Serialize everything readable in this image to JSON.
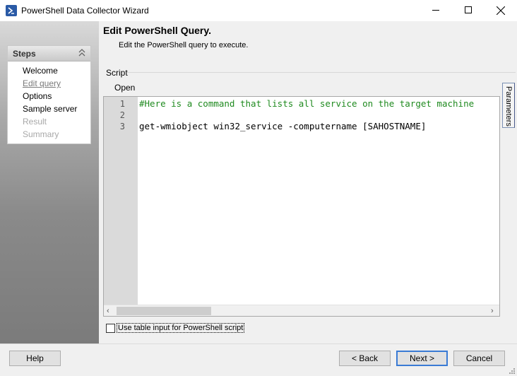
{
  "window": {
    "title": "PowerShell Data Collector Wizard"
  },
  "steps": {
    "header": "Steps",
    "items": [
      {
        "label": "Welcome",
        "state": "done"
      },
      {
        "label": "Edit query",
        "state": "current"
      },
      {
        "label": "Options",
        "state": "enabled"
      },
      {
        "label": "Sample server",
        "state": "enabled"
      },
      {
        "label": "Result",
        "state": "disabled"
      },
      {
        "label": "Summary",
        "state": "disabled"
      }
    ]
  },
  "page": {
    "title": "Edit PowerShell Query.",
    "description": "Edit the PowerShell query to execute."
  },
  "script": {
    "group_label": "Script",
    "open_label": "Open",
    "parameters_tab": "Parameters",
    "lines": [
      {
        "number": "1",
        "text": "#Here is a command that lists all service on the target machine",
        "kind": "comment"
      },
      {
        "number": "2",
        "text": "",
        "kind": "blank"
      },
      {
        "number": "3",
        "text": "get-wmiobject win32_service -computername [SAHOSTNAME]",
        "kind": "code"
      }
    ],
    "comment_color": "#1f8a1f"
  },
  "options": {
    "table_input_label": "Use table input for PowerShell script",
    "table_input_checked": false
  },
  "footer": {
    "help_label": "Help",
    "back_label": "< Back",
    "next_label": "Next >",
    "cancel_label": "Cancel"
  },
  "icons": {
    "app": "powershell-icon",
    "collapse": "chevron-up-double-icon"
  }
}
